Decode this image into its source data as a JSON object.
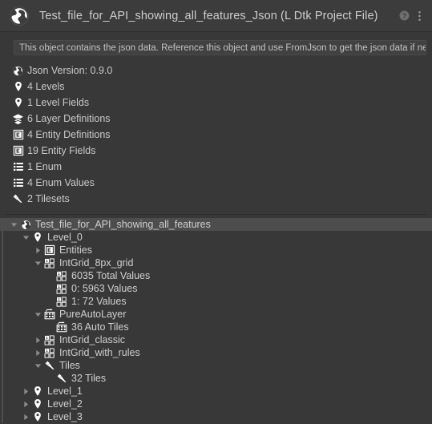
{
  "header": {
    "icon": "world-globe-icon",
    "title": "Test_file_for_API_showing_all_features_Json (L Dtk Project File)",
    "help_icon": "help-circle-icon",
    "menu_icon": "kebab-menu-icon"
  },
  "info": {
    "text": "This object contains the json data. Reference this object and use FromJson to get the json data if needed"
  },
  "summary": {
    "items": [
      {
        "icon": "world-globe-icon",
        "label": "Json Version: 0.9.0"
      },
      {
        "icon": "map-pin-icon",
        "label": "4 Levels"
      },
      {
        "icon": "map-pin-icon",
        "label": "1 Level Fields"
      },
      {
        "icon": "layers-stack-icon",
        "label": "6 Layer Definitions"
      },
      {
        "icon": "entity-box-icon",
        "label": "4 Entity Definitions"
      },
      {
        "icon": "entity-box-icon",
        "label": "19 Entity Fields"
      },
      {
        "icon": "bullet-list-icon",
        "label": "1 Enum"
      },
      {
        "icon": "bullet-list-icon",
        "label": "4 Enum Values"
      },
      {
        "icon": "tileset-brush-icon",
        "label": "2 Tilesets"
      }
    ]
  },
  "tree": {
    "rows": [
      {
        "indent": 0,
        "twisty": "down",
        "icon": "world-globe-icon",
        "label": "Test_file_for_API_showing_all_features",
        "selected": true
      },
      {
        "indent": 1,
        "twisty": "down",
        "icon": "map-pin-icon",
        "label": "Level_0",
        "selected": false
      },
      {
        "indent": 2,
        "twisty": "right",
        "icon": "entity-box-icon",
        "label": "Entities",
        "selected": false
      },
      {
        "indent": 2,
        "twisty": "down",
        "icon": "intgrid-icon",
        "label": "IntGrid_8px_grid",
        "selected": false
      },
      {
        "indent": 3,
        "twisty": "none",
        "icon": "intgrid-icon",
        "label": "6035 Total Values",
        "selected": false
      },
      {
        "indent": 3,
        "twisty": "none",
        "icon": "intgrid-icon",
        "label": "0: 5963 Values",
        "selected": false
      },
      {
        "indent": 3,
        "twisty": "none",
        "icon": "intgrid-icon",
        "label": "1: 72 Values",
        "selected": false
      },
      {
        "indent": 2,
        "twisty": "down",
        "icon": "auto-layer-icon",
        "label": "PureAutoLayer",
        "selected": false
      },
      {
        "indent": 3,
        "twisty": "none",
        "icon": "auto-layer-icon",
        "label": "36 Auto Tiles",
        "selected": false
      },
      {
        "indent": 2,
        "twisty": "right",
        "icon": "intgrid-icon",
        "label": "IntGrid_classic",
        "selected": false
      },
      {
        "indent": 2,
        "twisty": "right",
        "icon": "intgrid-icon",
        "label": "IntGrid_with_rules",
        "selected": false
      },
      {
        "indent": 2,
        "twisty": "down",
        "icon": "tileset-brush-icon",
        "label": "Tiles",
        "selected": false
      },
      {
        "indent": 3,
        "twisty": "none",
        "icon": "tileset-brush-icon",
        "label": "32 Tiles",
        "selected": false
      },
      {
        "indent": 1,
        "twisty": "right",
        "icon": "map-pin-icon",
        "label": "Level_1",
        "selected": false
      },
      {
        "indent": 1,
        "twisty": "right",
        "icon": "map-pin-icon",
        "label": "Level_2",
        "selected": false
      },
      {
        "indent": 1,
        "twisty": "right",
        "icon": "map-pin-icon",
        "label": "Level_3",
        "selected": false
      }
    ]
  },
  "colors": {
    "background": "#383838",
    "header_bg": "#3c3c3c",
    "selection": "#4d4d4d",
    "text": "#c9c9c9",
    "icon": "#ffffff"
  }
}
